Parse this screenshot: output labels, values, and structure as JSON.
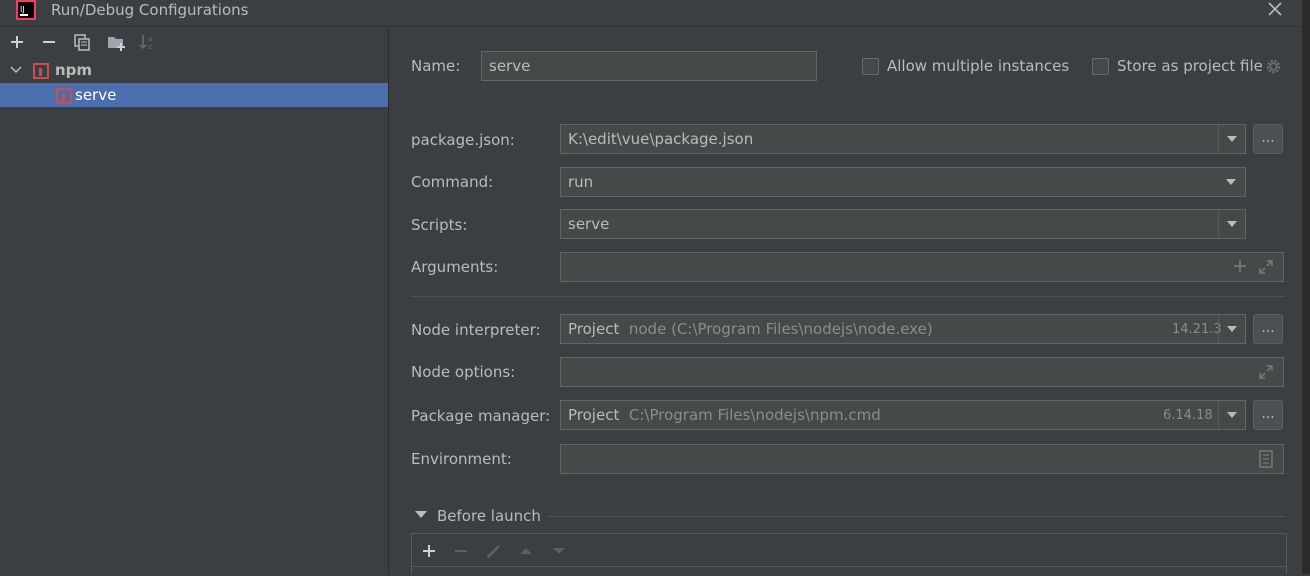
{
  "window": {
    "title": "Run/Debug Configurations",
    "logo_text": "IJ"
  },
  "left": {
    "toolbar": [
      "add-icon",
      "remove-icon",
      "copy-icon",
      "new-folder-icon",
      "sort-icon"
    ],
    "tree": {
      "group_label": "npm",
      "item_label": "serve"
    }
  },
  "form": {
    "name_label": "Name:",
    "name_value": "serve",
    "allow_multiple_label": "Allow multiple instances",
    "allow_multiple_checked": false,
    "store_project_label": "Store as project file",
    "store_project_checked": false,
    "package_json_label": "package.json:",
    "package_json_value": "K:\\edit\\vue\\package.json",
    "command_label": "Command:",
    "command_value": "run",
    "scripts_label": "Scripts:",
    "scripts_value": "serve",
    "arguments_label": "Arguments:",
    "arguments_value": "",
    "node_interpreter_label": "Node interpreter:",
    "node_interpreter_kind": "Project",
    "node_interpreter_path": "node (C:\\Program Files\\nodejs\\node.exe)",
    "node_interpreter_version": "14.21.3",
    "node_options_label": "Node options:",
    "node_options_value": "",
    "package_manager_label": "Package manager:",
    "package_manager_kind": "Project",
    "package_manager_path": "C:\\Program Files\\nodejs\\npm.cmd",
    "package_manager_version": "6.14.18",
    "environment_label": "Environment:",
    "environment_value": "",
    "ellipsis": "...",
    "before_launch_label": "Before launch"
  },
  "colors": {
    "background": "#3c3f41",
    "selection": "#4b6eaf",
    "field": "#45494a",
    "npm_red": "#c94f4f"
  }
}
